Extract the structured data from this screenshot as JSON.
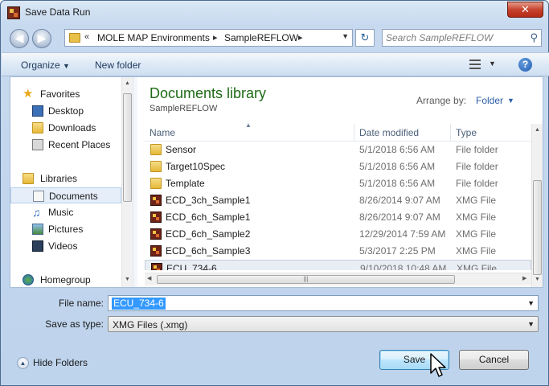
{
  "window": {
    "title": "Save Data Run",
    "close_label": "✕"
  },
  "address": {
    "crumbs": [
      "MOLE MAP Environments",
      "SampleREFLOW"
    ],
    "overflow": "«",
    "separator": "▸"
  },
  "search": {
    "placeholder": "Search SampleREFLOW"
  },
  "toolbar": {
    "organize": "Organize",
    "new_folder": "New folder",
    "help": "?"
  },
  "navigation": {
    "favorites": {
      "label": "Favorites",
      "items": [
        "Desktop",
        "Downloads",
        "Recent Places"
      ]
    },
    "libraries": {
      "label": "Libraries",
      "items": [
        "Documents",
        "Music",
        "Pictures",
        "Videos"
      ],
      "selected": "Documents"
    },
    "homegroup": "Homegroup"
  },
  "library": {
    "title": "Documents library",
    "subtitle": "SampleREFLOW",
    "arrange_label": "Arrange by:",
    "arrange_value": "Folder"
  },
  "columns": {
    "name": "Name",
    "date": "Date modified",
    "type": "Type"
  },
  "files": [
    {
      "name": "Sensor",
      "date": "5/1/2018 6:56 AM",
      "type": "File folder",
      "icon": "folder-icon"
    },
    {
      "name": "Target10Spec",
      "date": "5/1/2018 6:56 AM",
      "type": "File folder",
      "icon": "folder-icon"
    },
    {
      "name": "Template",
      "date": "5/1/2018 6:56 AM",
      "type": "File folder",
      "icon": "folder-icon"
    },
    {
      "name": "ECD_3ch_Sample1",
      "date": "8/26/2014 9:07 AM",
      "type": "XMG File",
      "icon": "xmg-file-icon"
    },
    {
      "name": "ECD_6ch_Sample1",
      "date": "8/26/2014 9:07 AM",
      "type": "XMG File",
      "icon": "xmg-file-icon"
    },
    {
      "name": "ECD_6ch_Sample2",
      "date": "12/29/2014 7:59 AM",
      "type": "XMG File",
      "icon": "xmg-file-icon"
    },
    {
      "name": "ECD_6ch_Sample3",
      "date": "5/3/2017 2:25 PM",
      "type": "XMG File",
      "icon": "xmg-file-icon"
    },
    {
      "name": "ECU_734-6",
      "date": "9/10/2018 10:48 AM",
      "type": "XMG File",
      "icon": "xmg-file-icon"
    }
  ],
  "selected_file": "ECU_734-6",
  "form": {
    "file_name_label": "File name:",
    "file_name_value": "ECU_734-6",
    "save_type_label": "Save as type:",
    "save_type_value": "XMG Files (.xmg)"
  },
  "footer": {
    "hide_folders": "Hide Folders",
    "save": "Save",
    "cancel": "Cancel"
  }
}
